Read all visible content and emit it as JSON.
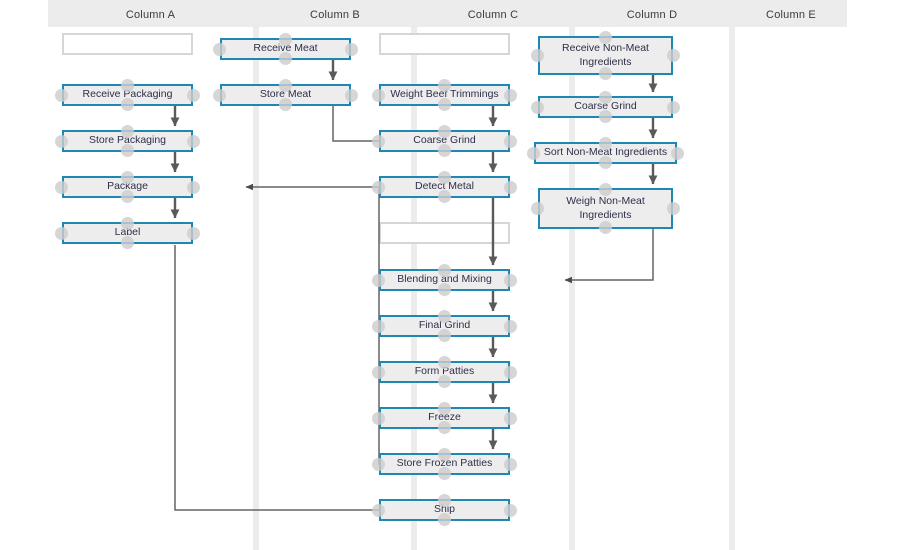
{
  "diagram": {
    "title": "Frozen Beef Patty Production Process Flow",
    "accent_color": "#1f87b4",
    "node_fill": "#ededed",
    "node_text_color": "#2d2f4a",
    "lane_band_color": "#ececec",
    "connector_color": "#646464",
    "empty_node_border": "#d6d6d6"
  },
  "columns": [
    {
      "id": "a",
      "label": "Column A"
    },
    {
      "id": "b",
      "label": "Column B"
    },
    {
      "id": "c",
      "label": "Column C"
    },
    {
      "id": "d",
      "label": "Column D"
    },
    {
      "id": "e",
      "label": "Column E"
    }
  ],
  "nodes": {
    "a_empty": {
      "label": "",
      "column": "Column A",
      "empty": true
    },
    "a_receive_pack": {
      "label": "Receive Packaging",
      "column": "Column A"
    },
    "a_store_pack": {
      "label": "Store Packaging",
      "column": "Column A"
    },
    "a_package": {
      "label": "Package",
      "column": "Column A"
    },
    "a_label": {
      "label": "Label",
      "column": "Column A"
    },
    "b_receive_meat": {
      "label": "Receive Meat",
      "column": "Column B"
    },
    "b_store_meat": {
      "label": "Store Meat",
      "column": "Column B"
    },
    "c_empty_top": {
      "label": "",
      "column": "Column C",
      "empty": true
    },
    "c_weight_beef": {
      "label": "Weight Beef Trimmings",
      "column": "Column C"
    },
    "c_coarse_grind": {
      "label": "Coarse Grind",
      "column": "Column C"
    },
    "c_detect_metal": {
      "label": "Detect Metal",
      "column": "Column C"
    },
    "c_empty_mid": {
      "label": "",
      "column": "Column C",
      "empty": true
    },
    "c_blending": {
      "label": "Blending and Mixing",
      "column": "Column C"
    },
    "c_final_grind": {
      "label": "Final Grind",
      "column": "Column C"
    },
    "c_form_patties": {
      "label": "Form Patties",
      "column": "Column C"
    },
    "c_freeze": {
      "label": "Freeze",
      "column": "Column C"
    },
    "c_store_frozen": {
      "label": "Store Frozen Patties",
      "column": "Column C"
    },
    "c_ship": {
      "label": "Ship",
      "column": "Column C"
    },
    "d_receive_nm": {
      "label": "Receive Non-Meat Ingredients",
      "column": "Column D"
    },
    "d_coarse_grind": {
      "label": "Coarse Grind",
      "column": "Column D"
    },
    "d_sort_nm": {
      "label": "Sort Non-Meat Ingredients",
      "column": "Column D"
    },
    "d_weigh_nm": {
      "label": "Weigh Non-Meat Ingredients",
      "column": "Column D"
    }
  },
  "edges": [
    {
      "from": "a_receive_pack",
      "to": "a_store_pack",
      "kind": "vertical"
    },
    {
      "from": "a_store_pack",
      "to": "a_package",
      "kind": "vertical"
    },
    {
      "from": "a_package",
      "to": "a_label",
      "kind": "vertical"
    },
    {
      "from": "b_receive_meat",
      "to": "b_store_meat",
      "kind": "vertical"
    },
    {
      "from": "b_store_meat",
      "to": "c_coarse_grind",
      "kind": "orthogonal"
    },
    {
      "from": "c_weight_beef",
      "to": "c_coarse_grind",
      "kind": "vertical"
    },
    {
      "from": "c_coarse_grind",
      "to": "c_detect_metal",
      "kind": "vertical"
    },
    {
      "from": "c_detect_metal",
      "to": "c_blending",
      "kind": "vertical"
    },
    {
      "from": "c_blending",
      "to": "c_final_grind",
      "kind": "vertical"
    },
    {
      "from": "c_final_grind",
      "to": "c_form_patties",
      "kind": "vertical"
    },
    {
      "from": "c_form_patties",
      "to": "c_freeze",
      "kind": "vertical"
    },
    {
      "from": "c_freeze",
      "to": "c_store_frozen",
      "kind": "vertical"
    },
    {
      "from": "c_store_frozen",
      "to": "a_package",
      "kind": "orthogonal"
    },
    {
      "from": "d_receive_nm",
      "to": "d_coarse_grind",
      "kind": "vertical"
    },
    {
      "from": "d_coarse_grind",
      "to": "d_sort_nm",
      "kind": "vertical"
    },
    {
      "from": "d_sort_nm",
      "to": "d_weigh_nm",
      "kind": "vertical"
    },
    {
      "from": "d_weigh_nm",
      "to": "c_blending",
      "kind": "orthogonal"
    },
    {
      "from": "a_label",
      "to": "c_ship",
      "kind": "orthogonal"
    }
  ]
}
